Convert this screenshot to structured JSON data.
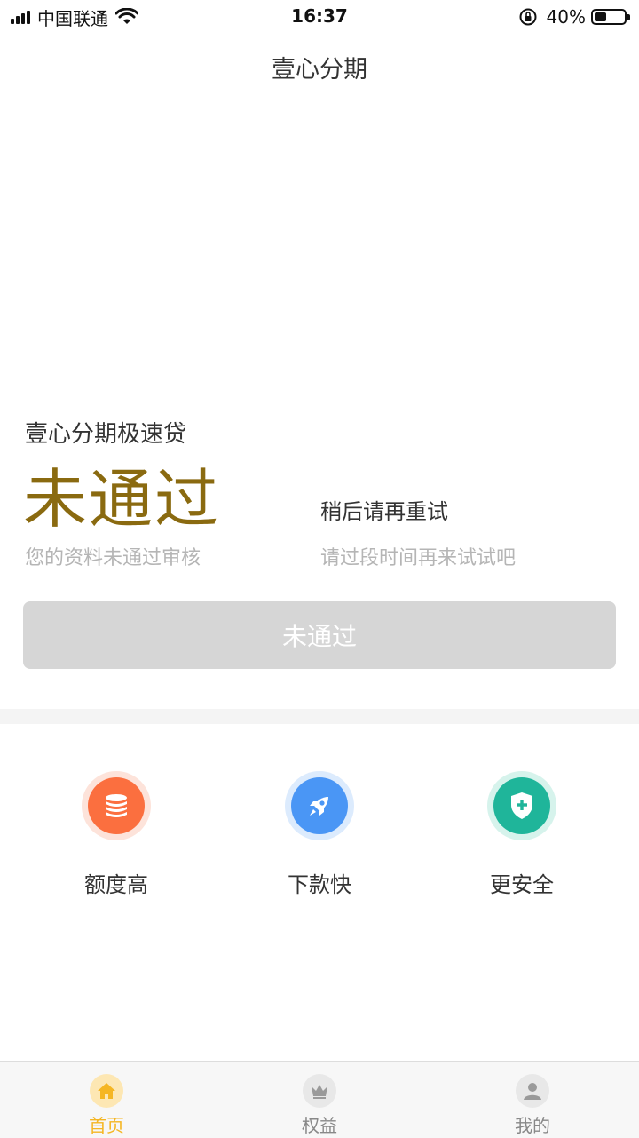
{
  "status_bar": {
    "carrier": "中国联通",
    "time": "16:37",
    "battery_percent": "40%",
    "battery_level": 0.4
  },
  "nav": {
    "title": "壹心分期"
  },
  "loan": {
    "product_name": "壹心分期极速贷",
    "status": "未通过",
    "status_desc": "您的资料未通过审核",
    "retry_title": "稍后请再重试",
    "retry_desc": "请过段时间再来试试吧",
    "button_label": "未通过"
  },
  "features": [
    {
      "label": "额度高",
      "icon": "database-coins-icon",
      "color": "#fb6f3f"
    },
    {
      "label": "下款快",
      "icon": "rocket-icon",
      "color": "#4a96f5"
    },
    {
      "label": "更安全",
      "icon": "shield-plus-icon",
      "color": "#1fb59a"
    }
  ],
  "tabs": [
    {
      "label": "首页",
      "icon": "home-icon",
      "active": true
    },
    {
      "label": "权益",
      "icon": "crown-icon",
      "active": false
    },
    {
      "label": "我的",
      "icon": "user-icon",
      "active": false
    }
  ],
  "colors": {
    "accent": "#f5b623",
    "status_text": "#8a6a10",
    "disabled_button": "#d6d6d6",
    "inactive_tab": "#888888"
  }
}
